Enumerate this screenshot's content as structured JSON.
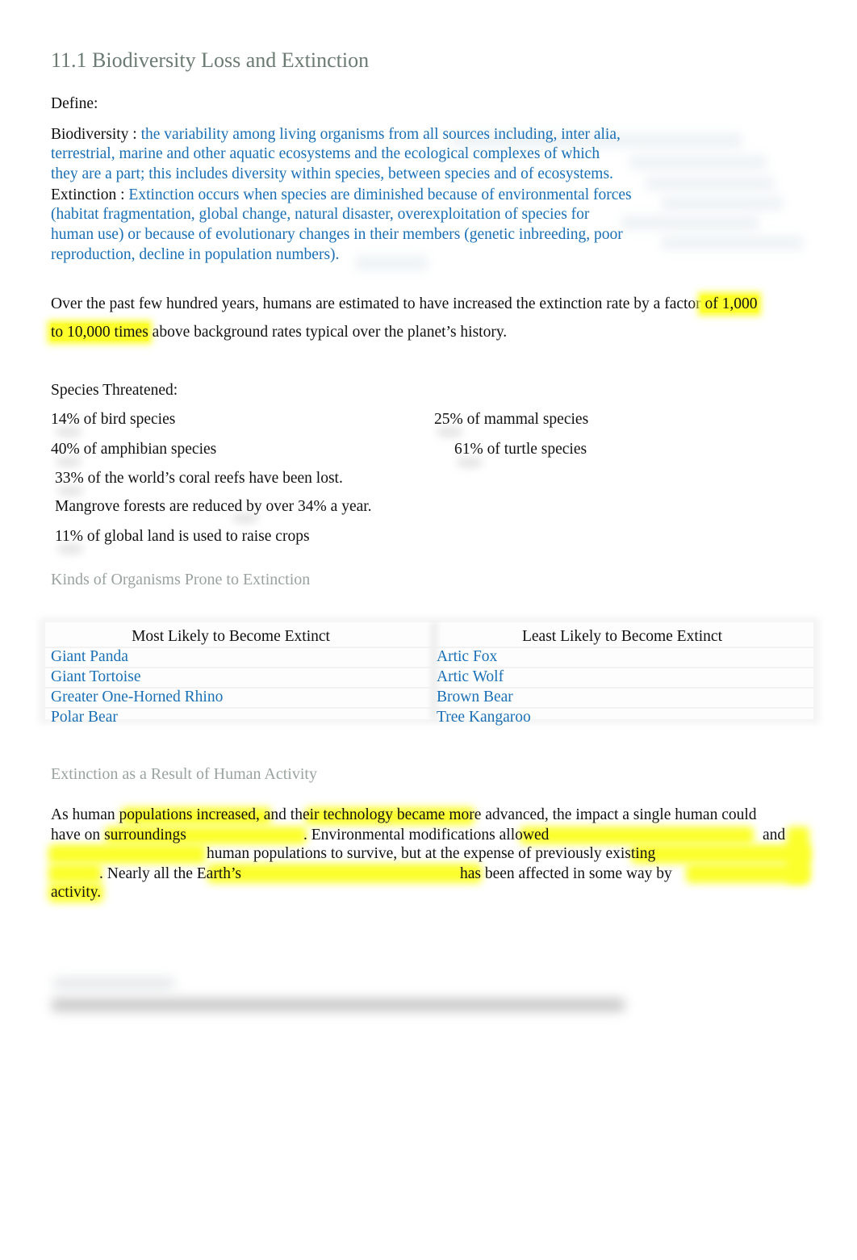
{
  "document": {
    "title": "11.1 Biodiversity Loss and Extinction",
    "define_label": "Define:",
    "definitions": [
      {
        "term": "Biodiversity :",
        "lines": [
          "the variability among living organisms from all sources including, inter alia,",
          "terrestrial, marine and other aquatic ecosystems and the ecological complexes of which",
          "they are a part; this includes diversity within species, between species and of ecosystems."
        ]
      },
      {
        "term": "Extinction :",
        "lines": [
          "Extinction occurs when species are diminished because of environmental forces",
          "(habitat fragmentation, global change, natural disaster, overexploitation of species for",
          "human use) or because of evolutionary changes in their members (genetic inbreeding, poor",
          "reproduction, decline in population numbers)."
        ]
      }
    ],
    "extinction_rate": {
      "line1_plain": "Over the past few hundred years, humans are estimated to have increased the extinction rate by a factor",
      "line1_highlight": " of 1,000",
      "line2_highlight": "to 10,000 times",
      "line2_plain": " above background rates typical over the planet’s history."
    },
    "species_threatened": {
      "heading": "Species Threatened:",
      "left": [
        "14% of bird species",
        "40% of amphibian species"
      ],
      "right": [
        "25% of mammal species",
        "61% of turtle species"
      ],
      "facts": [
        "33% of the world’s coral reefs have been lost.",
        "Mangrove forests are reduced by over 34% a year.",
        "11% of global land is used to raise crops"
      ]
    },
    "prone_section": {
      "heading": "Kinds of Organisms Prone to Extinction",
      "table": {
        "headers": [
          "Most Likely to Become Extinct",
          "Least Likely to Become Extinct"
        ],
        "most_likely": [
          "Giant Panda",
          "Giant Tortoise",
          "Greater One-Horned Rhino",
          "Polar Bear"
        ],
        "least_likely": [
          "Artic Fox",
          "Artic Wolf",
          "Brown Bear",
          "Tree Kangaroo"
        ]
      }
    },
    "human_activity": {
      "heading": "Extinction as a Result of Human Activity",
      "l1_a": "As human ",
      "l1_b": "populations increased",
      "l1_c": ", and ",
      "l1_d": "their technology became",
      "l1_e": " more advanced, the impact a single human could",
      "l2_a": "have on ",
      "l2_b": "surroundings",
      "l2_c": ".   Environmental modifications ",
      "l2_d": "allowed",
      "l2_e": "and",
      "l3_a": "human",
      "l3_b": " populations to survive, but at the expense of previously ",
      "l3_c": "existing",
      "l4_a": ".  Nearly all the ",
      "l4_b": "Earth’s",
      "l4_c": "has been affected in some way by",
      "l5": "activity."
    }
  }
}
